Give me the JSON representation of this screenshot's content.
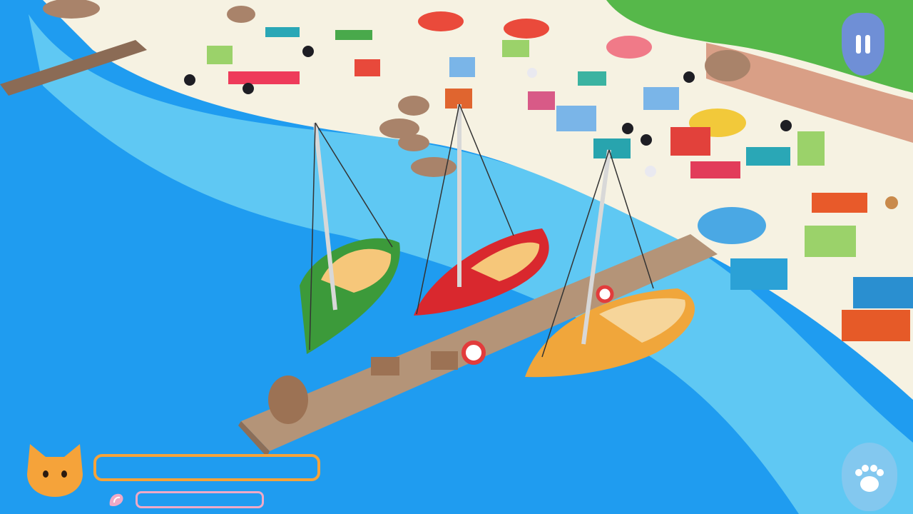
{
  "scene": {
    "description_icons": [
      "beach-scene",
      "sailboat",
      "dock",
      "cat"
    ],
    "boats": [
      {
        "color": "#3c9a3a"
      },
      {
        "color": "#d9282e"
      },
      {
        "color": "#f0a63b"
      }
    ]
  },
  "hud": {
    "pause_icon": "pause-icon",
    "cat_icon": "cat-head-icon",
    "shell_icon": "shell-icon",
    "paw_icon": "paw-icon",
    "main_progress": 0.0,
    "shell_progress": 0.0,
    "colors": {
      "main_bar": "#f5a33a",
      "shell_bar": "#f0a9c6",
      "pause_button": "#6f8fd6",
      "water": "#1f9cf0",
      "sand": "#f6f2e2"
    }
  }
}
